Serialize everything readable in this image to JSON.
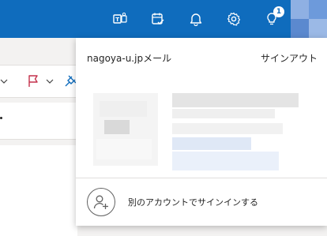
{
  "topbar": {
    "background": "#0f6cbd",
    "icons": [
      {
        "name": "teams-icon"
      },
      {
        "name": "my-day-icon"
      },
      {
        "name": "bell-icon"
      },
      {
        "name": "gear-icon"
      },
      {
        "name": "tips-lightbulb-icon"
      }
    ],
    "tips_badge": "1"
  },
  "account_flyout": {
    "org_name": "nagoya-u.jpメール",
    "sign_out": "サインアウト",
    "add_account_label": "別のアカウントでサインインする",
    "add_account_icon": "person-add-icon"
  }
}
